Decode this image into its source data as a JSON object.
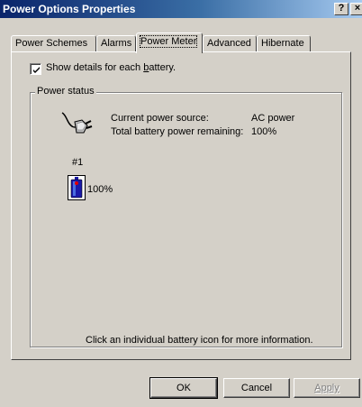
{
  "window": {
    "title": "Power Options Properties",
    "help_label": "?",
    "close_label": "×"
  },
  "tabs": [
    {
      "label": "Power Schemes"
    },
    {
      "label": "Alarms"
    },
    {
      "label": "Power Meter",
      "active": true
    },
    {
      "label": "Advanced"
    },
    {
      "label": "Hibernate"
    }
  ],
  "show_details": {
    "checked": true,
    "label_before": "Show details for each ",
    "label_underlined": "b",
    "label_after": "attery."
  },
  "power_status": {
    "legend": "Power status",
    "source_label": "Current power source:",
    "source_value": "AC power",
    "remaining_label": "Total battery power remaining:",
    "remaining_value": "100%",
    "icon": "ac-plug-icon"
  },
  "batteries": [
    {
      "number": "#1",
      "percent": "100%",
      "icon": "battery-icon",
      "level": 1.0
    }
  ],
  "hint": "Click an individual battery icon for more information.",
  "buttons": {
    "ok": "OK",
    "cancel": "Cancel",
    "apply": "Apply"
  }
}
